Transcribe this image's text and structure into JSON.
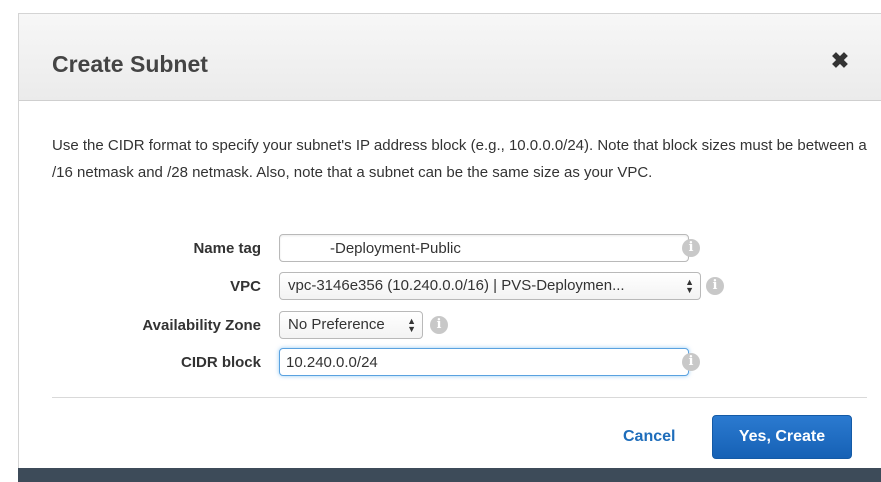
{
  "dialog": {
    "title": "Create Subnet",
    "close_symbol": "✖",
    "description": "Use the CIDR format to specify your subnet's IP address block (e.g., 10.0.0.0/24). Note that block sizes must be between a /16 netmask and /28 netmask. Also, note that a subnet can be the same size as your VPC."
  },
  "form": {
    "name_tag": {
      "label": "Name tag",
      "value": "-Deployment-Public"
    },
    "vpc": {
      "label": "VPC",
      "selected": "vpc-3146e356 (10.240.0.0/16) | PVS-Deploymen..."
    },
    "availability_zone": {
      "label": "Availability Zone",
      "selected": "No Preference"
    },
    "cidr_block": {
      "label": "CIDR block",
      "value": "10.240.0.0/24"
    }
  },
  "actions": {
    "cancel_label": "Cancel",
    "create_label": "Yes, Create"
  },
  "icons": {
    "info": "i",
    "select_arrows": "▲▼"
  },
  "colors": {
    "primary_button": "#1e6dbb",
    "link": "#1e6dbb",
    "header_bg": "#f0f0f0",
    "focus_border": "#5aa2e0"
  }
}
